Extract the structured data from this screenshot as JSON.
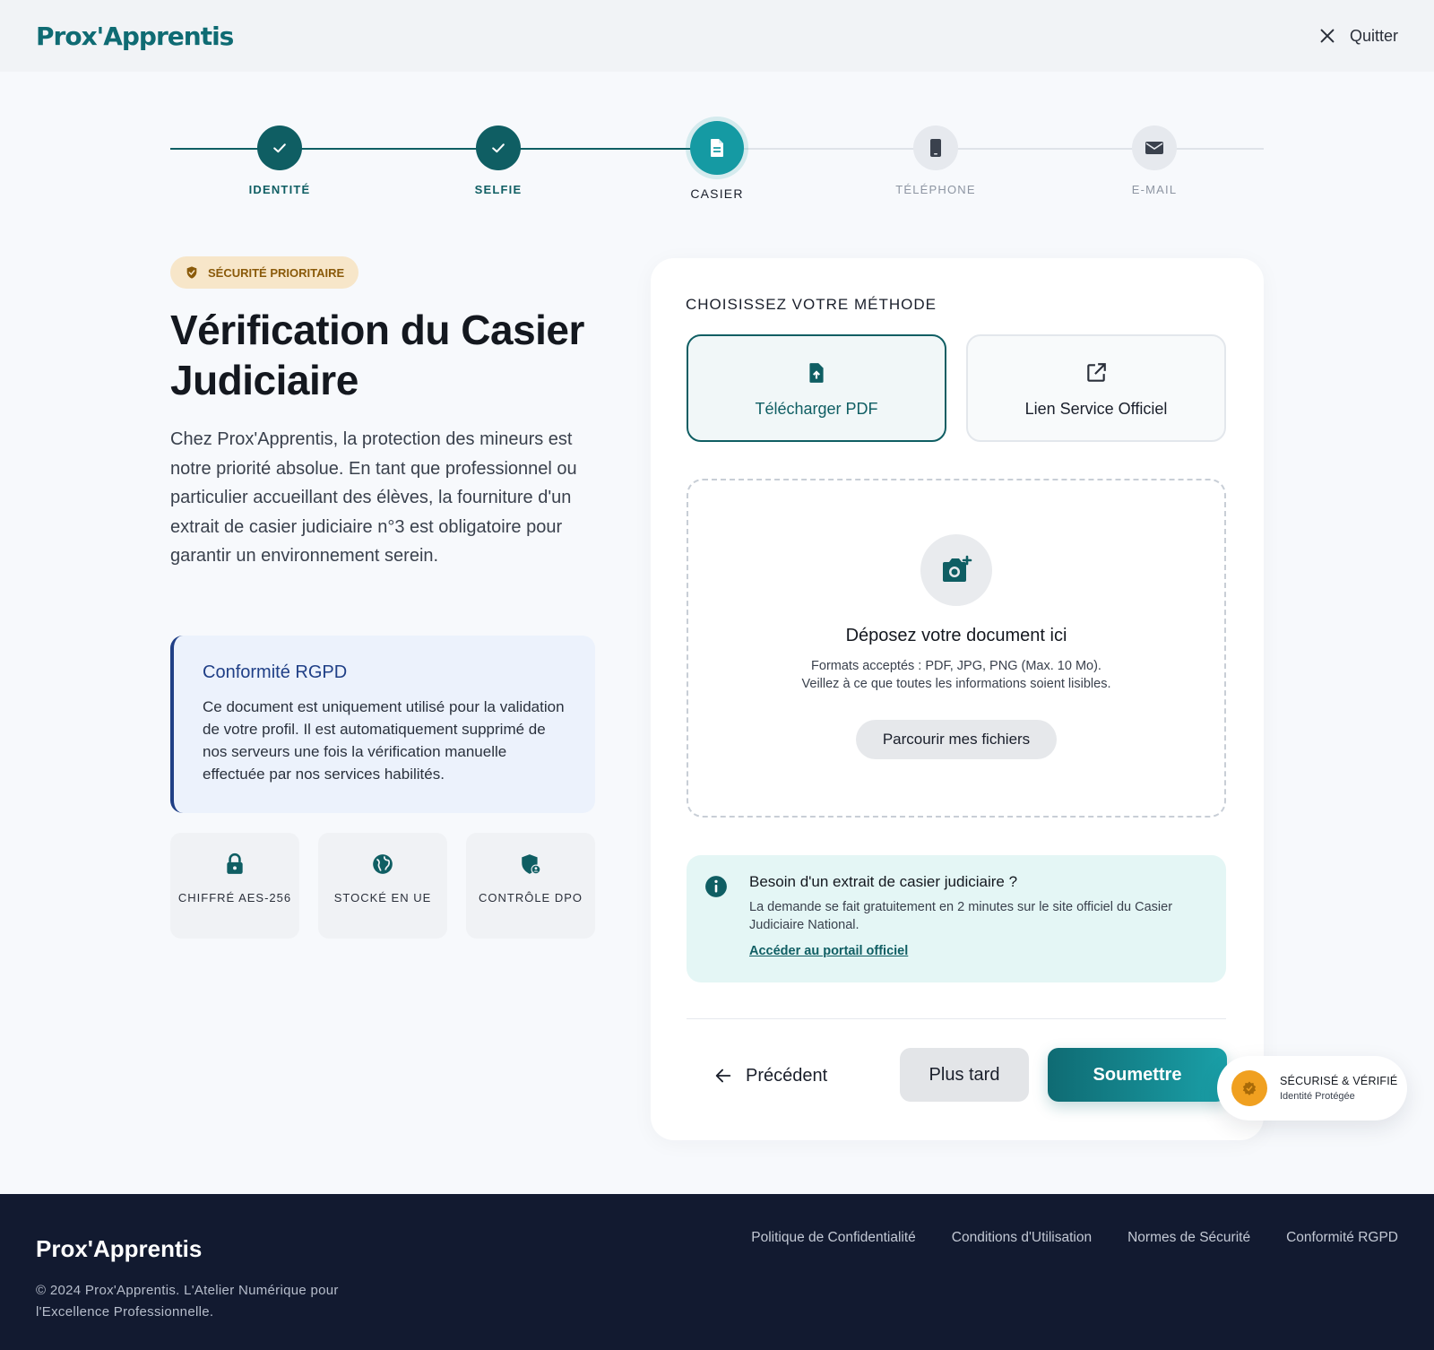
{
  "header": {
    "brand": "Prox'Apprentis",
    "quit_label": "Quitter"
  },
  "steps": [
    {
      "label": "IDENTITÉ",
      "state": "done",
      "icon": "check-icon"
    },
    {
      "label": "SELFIE",
      "state": "done",
      "icon": "check-icon"
    },
    {
      "label": "CASIER",
      "state": "active",
      "icon": "document-icon"
    },
    {
      "label": "TÉLÉPHONE",
      "state": "todo",
      "icon": "phone-icon"
    },
    {
      "label": "E-MAIL",
      "state": "todo",
      "icon": "mail-icon"
    }
  ],
  "left": {
    "badge": "SÉCURITÉ PRIORITAIRE",
    "title": "Vérification du Casier Judiciaire",
    "intro": "Chez Prox'Apprentis, la protection des mineurs est notre priorité absolue. En tant que professionnel ou particulier accueillant des élèves, la fourniture d'un extrait de casier judiciaire n°3 est obligatoire pour garantir un environnement serein.",
    "rgpd": {
      "title": "Conformité RGPD",
      "text": "Ce document est uniquement utilisé pour la validation de votre profil. Il est automatiquement supprimé de nos serveurs une fois la vérification manuelle effectuée par nos services habilités."
    },
    "features": [
      {
        "label": "CHIFFRÉ AES-256",
        "icon": "lock-icon"
      },
      {
        "label": "STOCKÉ EN UE",
        "icon": "globe-icon"
      },
      {
        "label": "CONTRÔLE DPO",
        "icon": "shield-user-icon"
      }
    ]
  },
  "card": {
    "choose_label": "CHOISISSEZ VOTRE MÉTHODE",
    "methods": [
      {
        "label": "Télécharger PDF",
        "icon": "file-upload-icon",
        "selected": true
      },
      {
        "label": "Lien Service Officiel",
        "icon": "external-link-icon",
        "selected": false
      }
    ],
    "drop": {
      "title": "Déposez votre document ici",
      "line1": "Formats acceptés : PDF, JPG, PNG (Max. 10 Mo).",
      "line2": "Veillez à ce que toutes les informations soient lisibles.",
      "browse_label": "Parcourir mes fichiers"
    },
    "info": {
      "title": "Besoin d'un extrait de casier judiciaire ?",
      "text": "La demande se fait gratuitement en 2 minutes sur le site officiel du Casier Judiciaire National.",
      "link": "Accéder au portail officiel"
    },
    "prev_label": "Précédent",
    "later_label": "Plus tard",
    "submit_label": "Soumettre"
  },
  "secure_badge": {
    "title": "SÉCURISÉ & VÉRIFIÉ",
    "subtitle": "Identité Protégée"
  },
  "footer": {
    "brand": "Prox'Apprentis",
    "copyright": "© 2024 Prox'Apprentis. L'Atelier Numérique pour l'Excellence Professionnelle.",
    "links": [
      "Politique de Confidentialité",
      "Conditions d'Utilisation",
      "Normes de Sécurité",
      "Conformité RGPD"
    ]
  },
  "colors": {
    "primary": "#0f5e63",
    "accent": "#159aa3",
    "badge_bg": "#f7e6c9",
    "footer_bg": "#121a30"
  }
}
